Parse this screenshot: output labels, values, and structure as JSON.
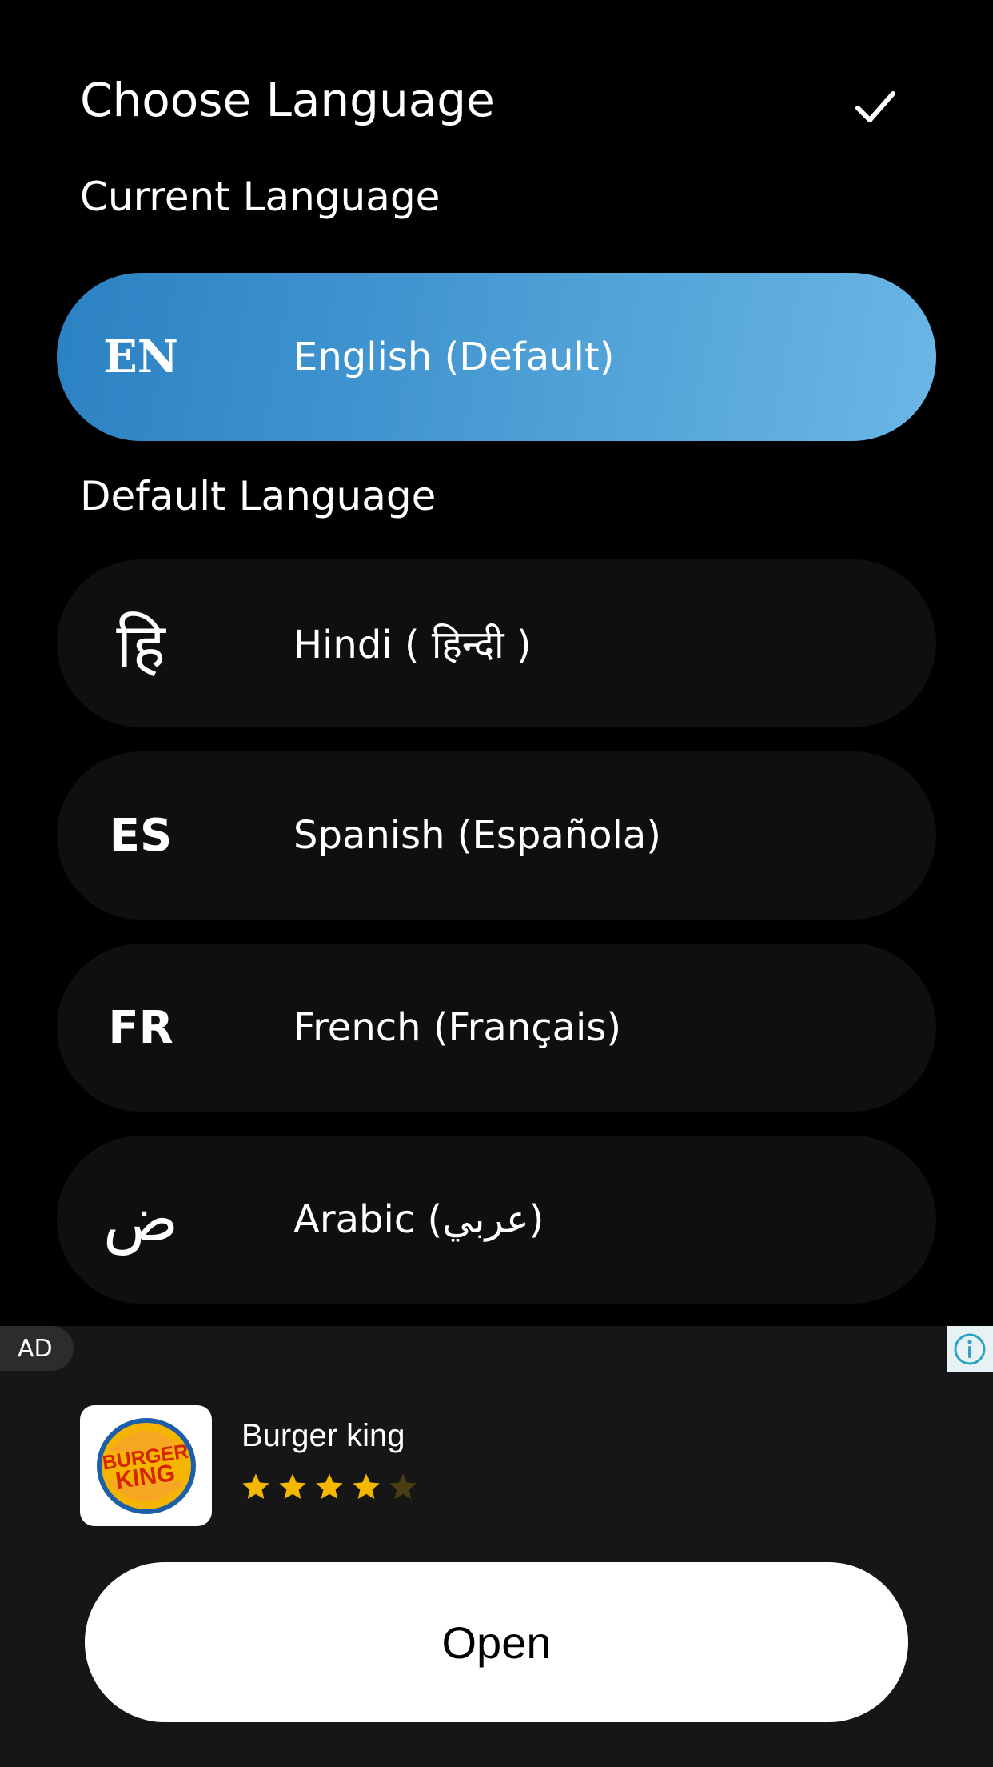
{
  "header": {
    "title": "Choose Language",
    "confirm_icon": "check-icon"
  },
  "sections": {
    "current_label": "Current Language",
    "default_label": "Default Language"
  },
  "current_language": {
    "code": "EN",
    "name": "English (Default)",
    "selected": true
  },
  "languages": [
    {
      "code": "हि",
      "name": "Hindi ( हिन्दी )"
    },
    {
      "code": "ES",
      "name": "Spanish (Española)"
    },
    {
      "code": "FR",
      "name": "French (Français)"
    },
    {
      "code": "ض",
      "name": "Arabic (عربي)"
    }
  ],
  "ad": {
    "badge": "AD",
    "info_icon": "info-icon",
    "advertiser": "Burger king",
    "logo_text": [
      "BURGER",
      "KING"
    ],
    "rating": 4,
    "rating_max": 5,
    "cta": "Open"
  },
  "colors": {
    "background": "#000000",
    "item_background": "#0f0f0f",
    "selected_gradient_start": "#2b82c2",
    "selected_gradient_end": "#6bb6e6",
    "ad_background": "#161616",
    "star_filled": "#f5b800",
    "star_empty": "#4a3e12",
    "info_icon": "#2aa4c0"
  }
}
